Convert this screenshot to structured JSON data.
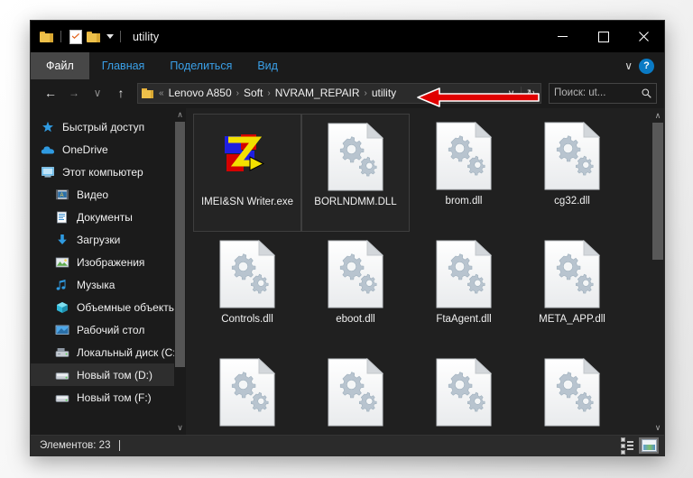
{
  "window": {
    "title": "utility",
    "quick_access": [
      {
        "name": "folder-icon",
        "label": "Properties"
      },
      {
        "name": "new-folder-icon",
        "label": "New folder"
      },
      {
        "name": "customize-dropdown",
        "label": "Customize Quick Access Toolbar"
      }
    ],
    "controls": {
      "minimize": "–",
      "maximize": "□",
      "close": "✕"
    }
  },
  "ribbon": {
    "tabs": [
      {
        "label": "Файл",
        "active": true
      },
      {
        "label": "Главная",
        "active": false
      },
      {
        "label": "Поделиться",
        "active": false
      },
      {
        "label": "Вид",
        "active": false
      }
    ],
    "expand_label": "∨",
    "help_label": "?"
  },
  "address": {
    "back": "←",
    "forward": "→",
    "recent": "∨",
    "up": "↑",
    "overflow": "«",
    "crumbs": [
      "Lenovo A850",
      "Soft",
      "NVRAM_REPAIR",
      "utility"
    ],
    "separator": "›",
    "dropdown": "∨",
    "refresh": "↻"
  },
  "search": {
    "value": "Поиск: ut...",
    "placeholder": "Поиск: ut...",
    "icon": "⌕"
  },
  "sidebar": {
    "items": [
      {
        "label": "Быстрый доступ",
        "icon": "star-icon",
        "indent": false,
        "selected": false
      },
      {
        "label": "OneDrive",
        "icon": "cloud-icon",
        "indent": false,
        "selected": false
      },
      {
        "label": "Этот компьютер",
        "icon": "computer-icon",
        "indent": false,
        "selected": false
      },
      {
        "label": "Видео",
        "icon": "video-icon",
        "indent": true,
        "selected": false
      },
      {
        "label": "Документы",
        "icon": "documents-icon",
        "indent": true,
        "selected": false
      },
      {
        "label": "Загрузки",
        "icon": "downloads-icon",
        "indent": true,
        "selected": false
      },
      {
        "label": "Изображения",
        "icon": "pictures-icon",
        "indent": true,
        "selected": false
      },
      {
        "label": "Музыка",
        "icon": "music-icon",
        "indent": true,
        "selected": false
      },
      {
        "label": "Объемные объекты",
        "icon": "3dobjects-icon",
        "indent": true,
        "selected": false
      },
      {
        "label": "Рабочий стол",
        "icon": "desktop-icon",
        "indent": true,
        "selected": false
      },
      {
        "label": "Локальный диск (C:)",
        "icon": "harddrive-icon",
        "indent": true,
        "selected": false
      },
      {
        "label": "Новый том (D:)",
        "icon": "drive-icon",
        "indent": true,
        "selected": true
      },
      {
        "label": "Новый том (F:)",
        "icon": "drive-icon",
        "indent": true,
        "selected": false
      }
    ],
    "scroll_up": "∧",
    "scroll_down": "∨"
  },
  "files": [
    {
      "name": "IMEI&SN Writer.exe",
      "icon": "zwriter-app-icon",
      "focused": true
    },
    {
      "name": "BORLNDMM.DLL",
      "icon": "dll-icon",
      "focused": true
    },
    {
      "name": "brom.dll",
      "icon": "dll-icon",
      "focused": false
    },
    {
      "name": "cg32.dll",
      "icon": "dll-icon",
      "focused": false
    },
    {
      "name": "Controls.dll",
      "icon": "dll-icon",
      "focused": false
    },
    {
      "name": "eboot.dll",
      "icon": "dll-icon",
      "focused": false
    },
    {
      "name": "FtaAgent.dll",
      "icon": "dll-icon",
      "focused": false
    },
    {
      "name": "META_APP.dll",
      "icon": "dll-icon",
      "focused": false
    },
    {
      "name": "",
      "icon": "dll-icon",
      "focused": false
    },
    {
      "name": "",
      "icon": "dll-icon",
      "focused": false
    },
    {
      "name": "",
      "icon": "dll-icon",
      "focused": false
    },
    {
      "name": "",
      "icon": "dll-icon",
      "focused": false
    }
  ],
  "content_scroll": {
    "up": "∧",
    "down": "∨"
  },
  "statusbar": {
    "items_text": "Элементов: 23",
    "view_details_label": "Таблица",
    "view_large_icons_label": "Крупные значки"
  },
  "annotation": {
    "type": "red-arrow",
    "points_at": "utility",
    "color": "#e00000"
  }
}
